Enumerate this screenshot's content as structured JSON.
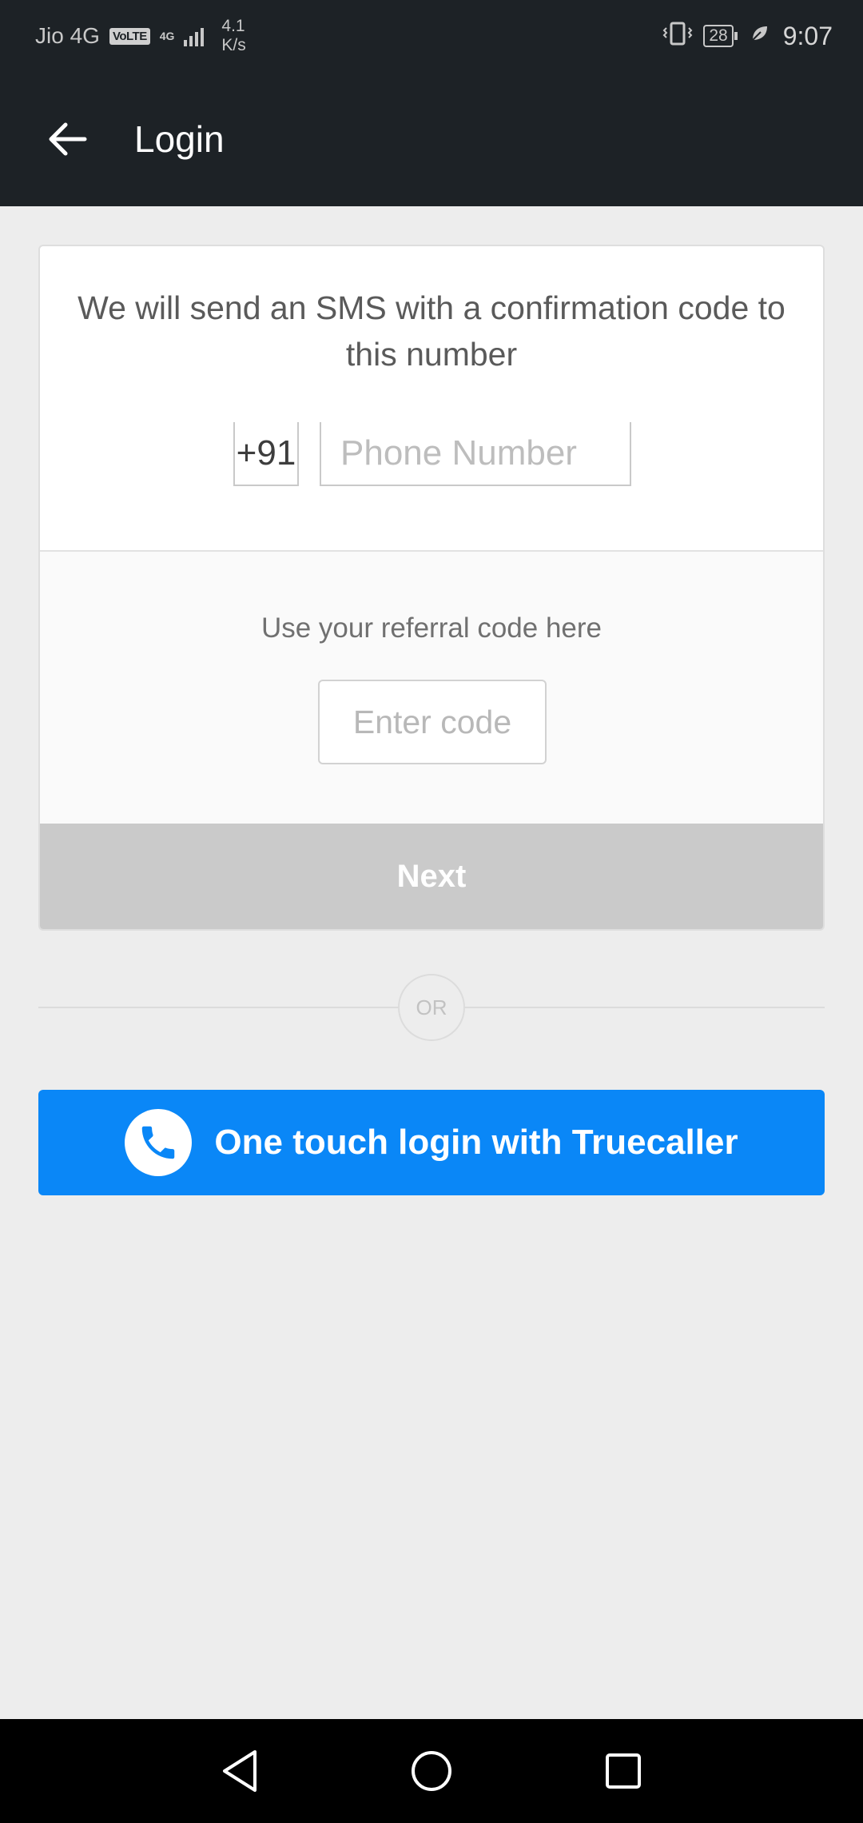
{
  "status_bar": {
    "carrier": "Jio 4G",
    "volte": "VoLTE",
    "network_type": "4G",
    "speed_value": "4.1",
    "speed_unit": "K/s",
    "battery": "28",
    "time": "9:07"
  },
  "app_bar": {
    "title": "Login",
    "back_icon": "arrow-left-icon"
  },
  "sms_section": {
    "message": "We will send an SMS with a confirmation code to this number",
    "country_code": "+91",
    "phone_placeholder": "Phone Number",
    "phone_value": ""
  },
  "referral_section": {
    "label": "Use your referral code here",
    "code_placeholder": "Enter code",
    "code_value": ""
  },
  "next_button": {
    "label": "Next",
    "enabled": false
  },
  "divider": {
    "label": "OR"
  },
  "truecaller_button": {
    "label": "One touch login with Truecaller",
    "icon": "phone-icon",
    "color": "#0a87f7"
  },
  "nav_bar": {
    "back": "triangle-back-icon",
    "home": "circle-home-icon",
    "recents": "square-recents-icon"
  },
  "colors": {
    "app_bar": "#1d2226",
    "background": "#ededed",
    "next_disabled": "#cacaca",
    "accent": "#0a87f7"
  }
}
